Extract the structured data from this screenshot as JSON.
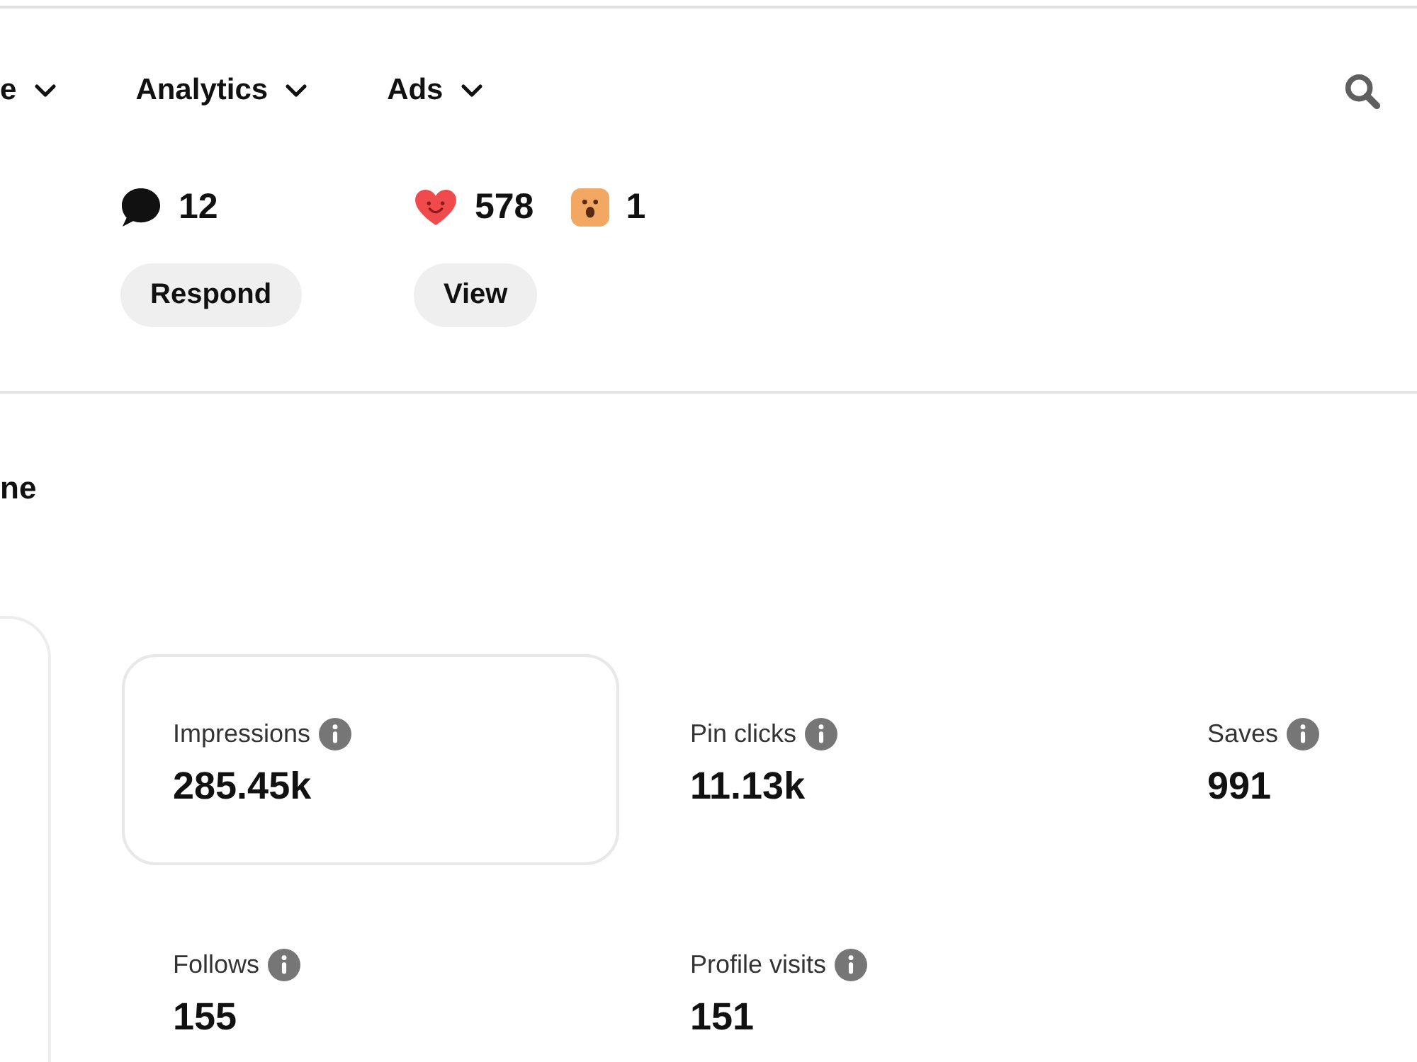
{
  "nav": {
    "items": [
      {
        "label": "e"
      },
      {
        "label": "Analytics"
      },
      {
        "label": "Ads"
      }
    ]
  },
  "activity": [
    {
      "counts": [
        {
          "kind": "comment",
          "value": "12"
        }
      ],
      "button": "Respond"
    },
    {
      "counts": [
        {
          "kind": "heart",
          "value": "578"
        },
        {
          "kind": "wow",
          "value": "1"
        }
      ],
      "button": "View"
    }
  ],
  "overview": {
    "title": "ne",
    "metrics": [
      {
        "label": "Impressions",
        "value": "285.45k",
        "selected": true
      },
      {
        "label": "Pin clicks",
        "value": "11.13k",
        "selected": false
      },
      {
        "label": "Saves",
        "value": "991",
        "selected": false
      },
      {
        "label": "Follows",
        "value": "155",
        "selected": false
      },
      {
        "label": "Profile visits",
        "value": "151",
        "selected": false
      }
    ]
  }
}
